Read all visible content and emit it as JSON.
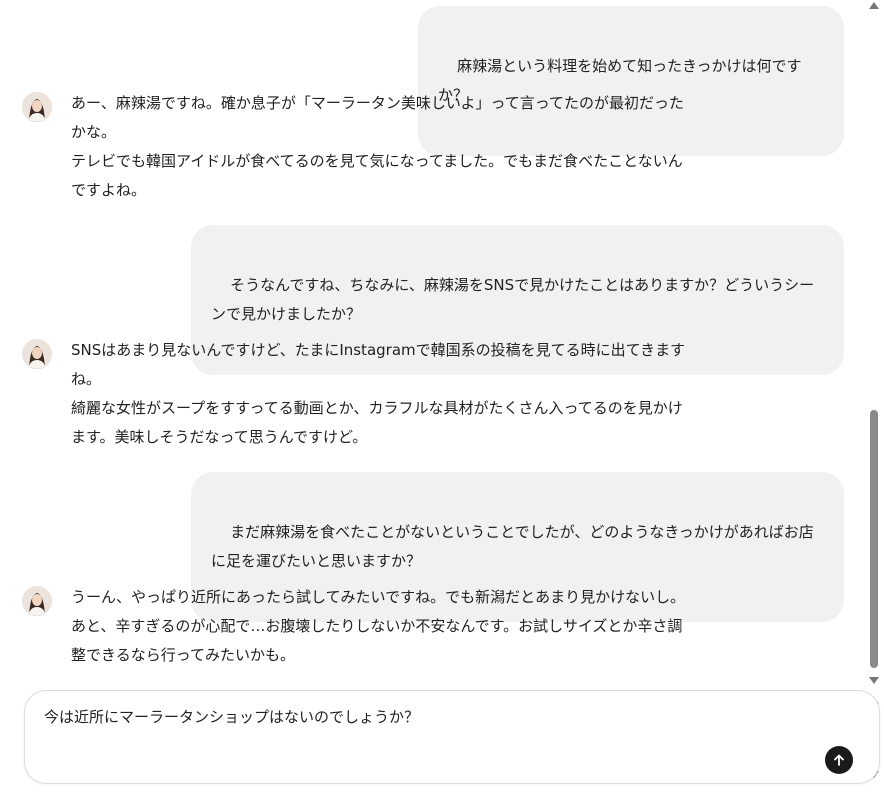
{
  "conversation": {
    "messages": [
      {
        "role": "user",
        "text": "麻辣湯という料理を始めて知ったきっかけは何ですか？"
      },
      {
        "role": "assistant",
        "text": "あー、麻辣湯ですね。確か息子が「マーラータン美味しいよ」って言ってたのが最初だった\nかな。\nテレビでも韓国アイドルが食べてるのを見て気になってました。でもまだ食べたことないん\nですよね。"
      },
      {
        "role": "user",
        "text": "そうなんですね、ちなみに、麻辣湯をSNSで見かけたことはありますか？どういうシー\nンで見かけましたか？"
      },
      {
        "role": "assistant",
        "text": "SNSはあまり見ないんですけど、たまにInstagramで韓国系の投稿を見てる時に出てきます\nね。\n綺麗な女性がスープをすすってる動画とか、カラフルな具材がたくさん入ってるのを見かけ\nます。美味しそうだなって思うんですけど。"
      },
      {
        "role": "user",
        "text": "まだ麻辣湯を食べたことがないということでしたが、どのようなきっかけがあればお店\nに足を運びたいと思いますか？"
      },
      {
        "role": "assistant",
        "text": "うーん、やっぱり近所にあったら試してみたいですね。でも新潟だとあまり見かけないし。\nあと、辛すぎるのが心配で…お腹壊したりしないか不安なんです。お試しサイズとか辛さ調\n整できるなら行ってみたいかも。"
      }
    ]
  },
  "composer": {
    "value": "今は近所にマーラータンショップはないのでしょうか？",
    "send_icon": "arrow-up-icon"
  },
  "colors": {
    "user_bubble": "#f1f1f1",
    "send_button": "#1a1a1a",
    "scrollbar_thumb": "#8a8a8a"
  }
}
